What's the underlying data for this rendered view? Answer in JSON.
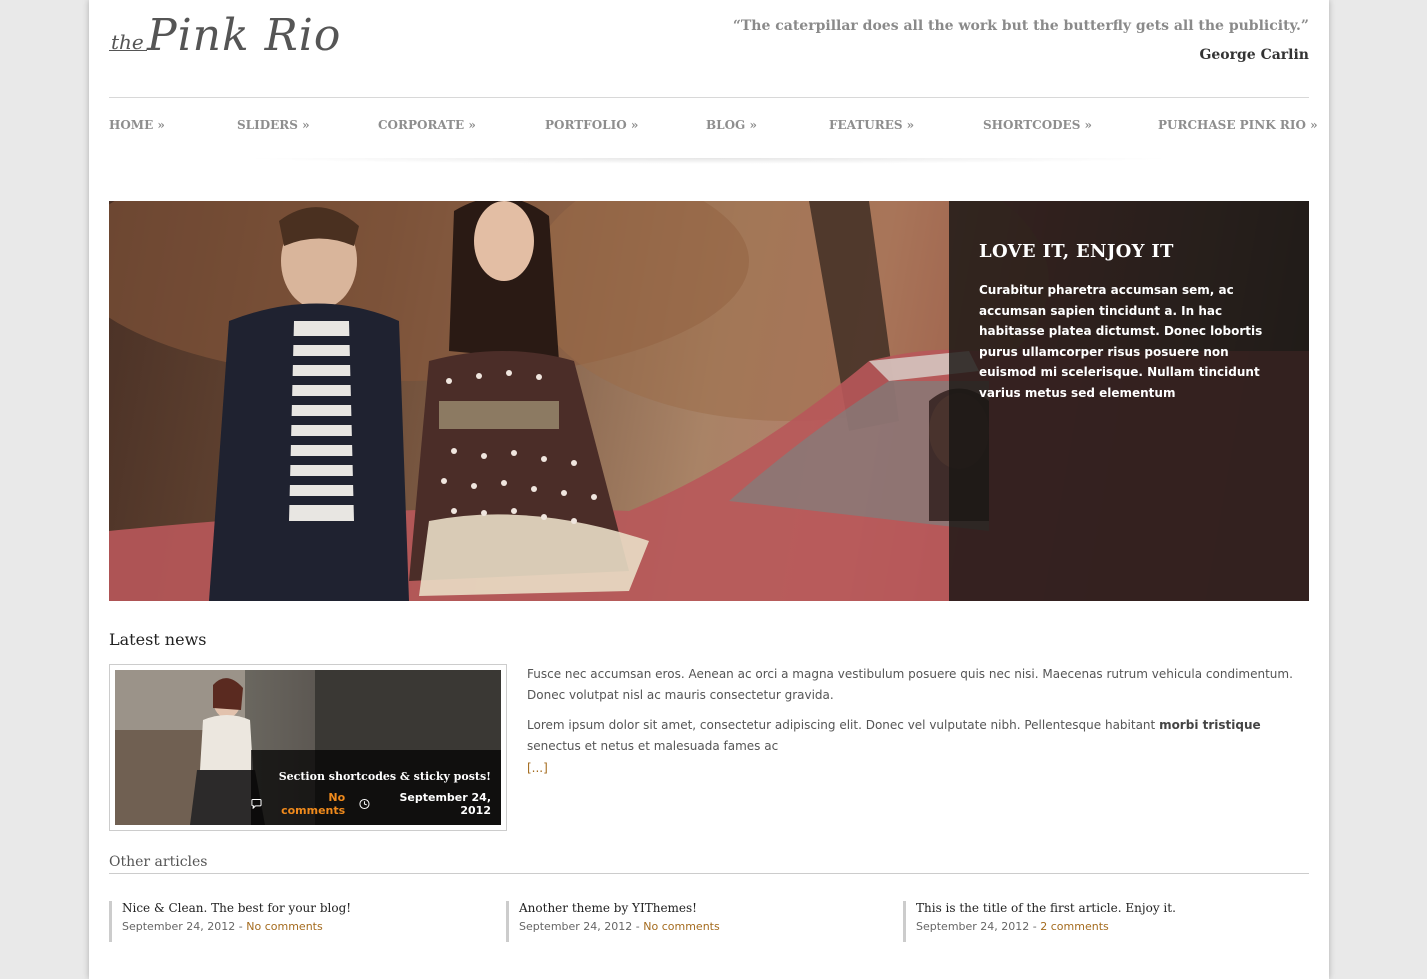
{
  "header": {
    "logo_the": "the",
    "logo_name": "Pink Rio",
    "quote": "“The caterpillar does all the work but the butterfly gets all the publicity.”",
    "quote_author": "George Carlin"
  },
  "nav": {
    "items": [
      {
        "label": "HOME »"
      },
      {
        "label": "SLIDERS »"
      },
      {
        "label": "CORPORATE »"
      },
      {
        "label": "PORTFOLIO »"
      },
      {
        "label": "BLOG »"
      },
      {
        "label": "FEATURES »"
      },
      {
        "label": "SHORTCODES »"
      },
      {
        "label": "PURCHASE PINK RIO »"
      }
    ]
  },
  "slider": {
    "title": "LOVE IT, ENJOY IT",
    "text": "Curabitur pharetra accumsan sem, ac accumsan sapien tincidunt a. In hac habitasse platea dictumst. Donec lobortis purus ullamcorper risus posuere non euismod mi scelerisque. Nullam tincidunt varius metus sed elementum"
  },
  "latest_news": {
    "heading": "Latest news",
    "post_title": "Section shortcodes & sticky posts!",
    "post_comments": "No comments",
    "post_date": "September 24, 2012",
    "para1": "Fusce nec accumsan eros. Aenean ac orci a magna vestibulum posuere quis nec nisi. Maecenas rutrum vehicula condimentum. Donec volutpat nisl ac mauris consectetur gravida.",
    "para2_before": "Lorem ipsum dolor sit amet, consectetur adipiscing elit. Donec vel vulputate nibh. Pellentesque habitant ",
    "para2_bold": "morbi tristique",
    "para2_after": " senectus et netus et malesuada fames ac",
    "read_more": "[...]"
  },
  "other_articles": {
    "heading": "Other articles",
    "items": [
      {
        "title": "Nice & Clean. The best for your blog!",
        "date": "September 24, 2012",
        "sep": " - ",
        "comments": "No comments"
      },
      {
        "title": "Another theme by YIThemes!",
        "date": "September 24, 2012",
        "sep": " - ",
        "comments": "No comments"
      },
      {
        "title": "This is the title of the first article. Enjoy it.",
        "date": "September 24, 2012",
        "sep": " - ",
        "comments": "2 comments"
      }
    ]
  },
  "colors": {
    "accent_orange": "#f08a1c",
    "link_brown": "#a46b1e",
    "nav_gray": "#8e8e8e"
  }
}
